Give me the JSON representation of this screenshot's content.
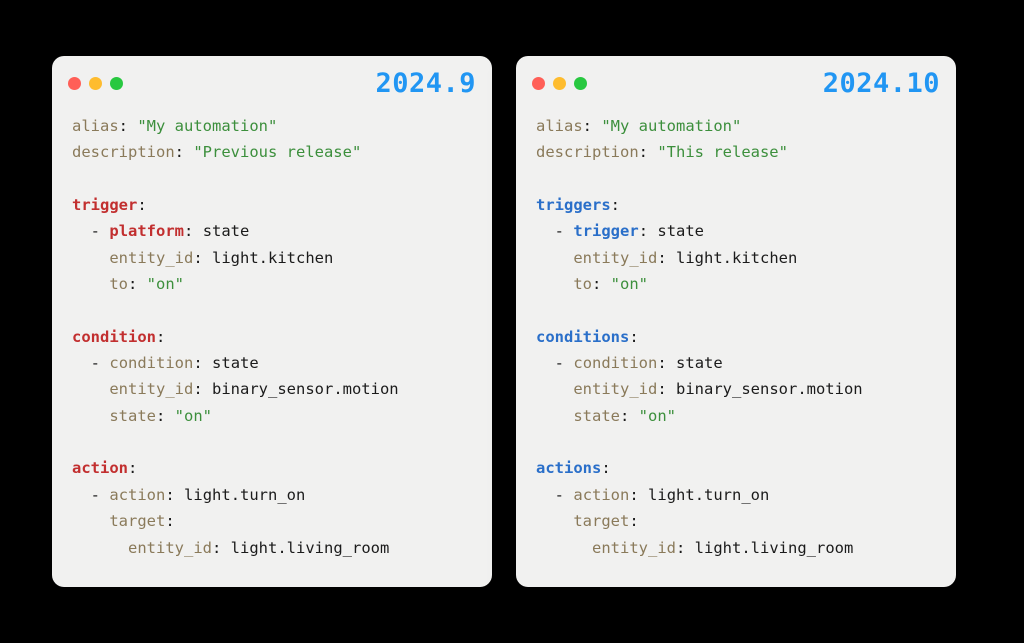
{
  "left": {
    "version": "2024.9",
    "headerKey": "trigger",
    "subKey": "platform",
    "conditionHeader": "condition",
    "actionHeader": "action"
  },
  "right": {
    "version": "2024.10",
    "headerKey": "triggers",
    "subKey": "trigger",
    "conditionHeader": "conditions",
    "actionHeader": "actions"
  },
  "common": {
    "aliasKey": "alias",
    "aliasValue": "\"My automation\"",
    "descriptionKey": "description",
    "leftDescValue": "\"Previous release\"",
    "rightDescValue": "\"This release\"",
    "triggerState": "state",
    "entityIdKey": "entity_id",
    "triggerEntity": "light.kitchen",
    "toKey": "to",
    "toValue": "\"on\"",
    "conditionKey": "condition",
    "conditionValue": "state",
    "conditionEntity": "binary_sensor.motion",
    "stateKey": "state",
    "stateValue": "\"on\"",
    "actionKey": "action",
    "actionValue": "light.turn_on",
    "targetKey": "target",
    "targetEntity": "light.living_room"
  }
}
